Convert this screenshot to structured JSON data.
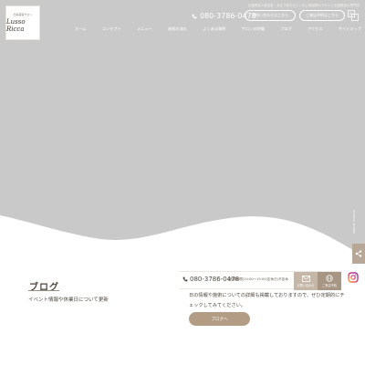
{
  "colors": {
    "hero_bg": "#c9c9c9",
    "accent": "#b39c84",
    "text": "#4e463e"
  },
  "header": {
    "logo_sub": "出張美容サロン",
    "logo_main": "Lusso Ricca",
    "notice": "出張美容×美容室｜あまり知られていない美容師のサロンと出張美容の専門店",
    "tel": "080-3786-0478",
    "contact_button": "お問い合わせはこちら",
    "reserve_button": "ご来店予約はこちら",
    "lang_icon": "translate-icon"
  },
  "nav": {
    "items": [
      "ホーム",
      "コンセプト",
      "メニュー",
      "施術の流れ",
      "よくある質問",
      "サロンの特徴",
      "ブログ",
      "アクセス",
      "サイトマップ"
    ]
  },
  "hero": {
    "vertical_text": "SCROLL DOWN"
  },
  "blog": {
    "title": "ブログ",
    "description": "イベント情報や休業日について更新"
  },
  "contact_bar": {
    "tel": "080-3786-0478",
    "hours": "[営業時間]10:00～19:00(定休日)不定休",
    "mail_label": "お問い合わせ",
    "reserve_label": "ご来店予約"
  },
  "body": {
    "text": "日の情報や施術についての詳細も掲載しておりますので、ぜひ定期的にチェックしてみてください。"
  },
  "blog_button": "ブログへ"
}
